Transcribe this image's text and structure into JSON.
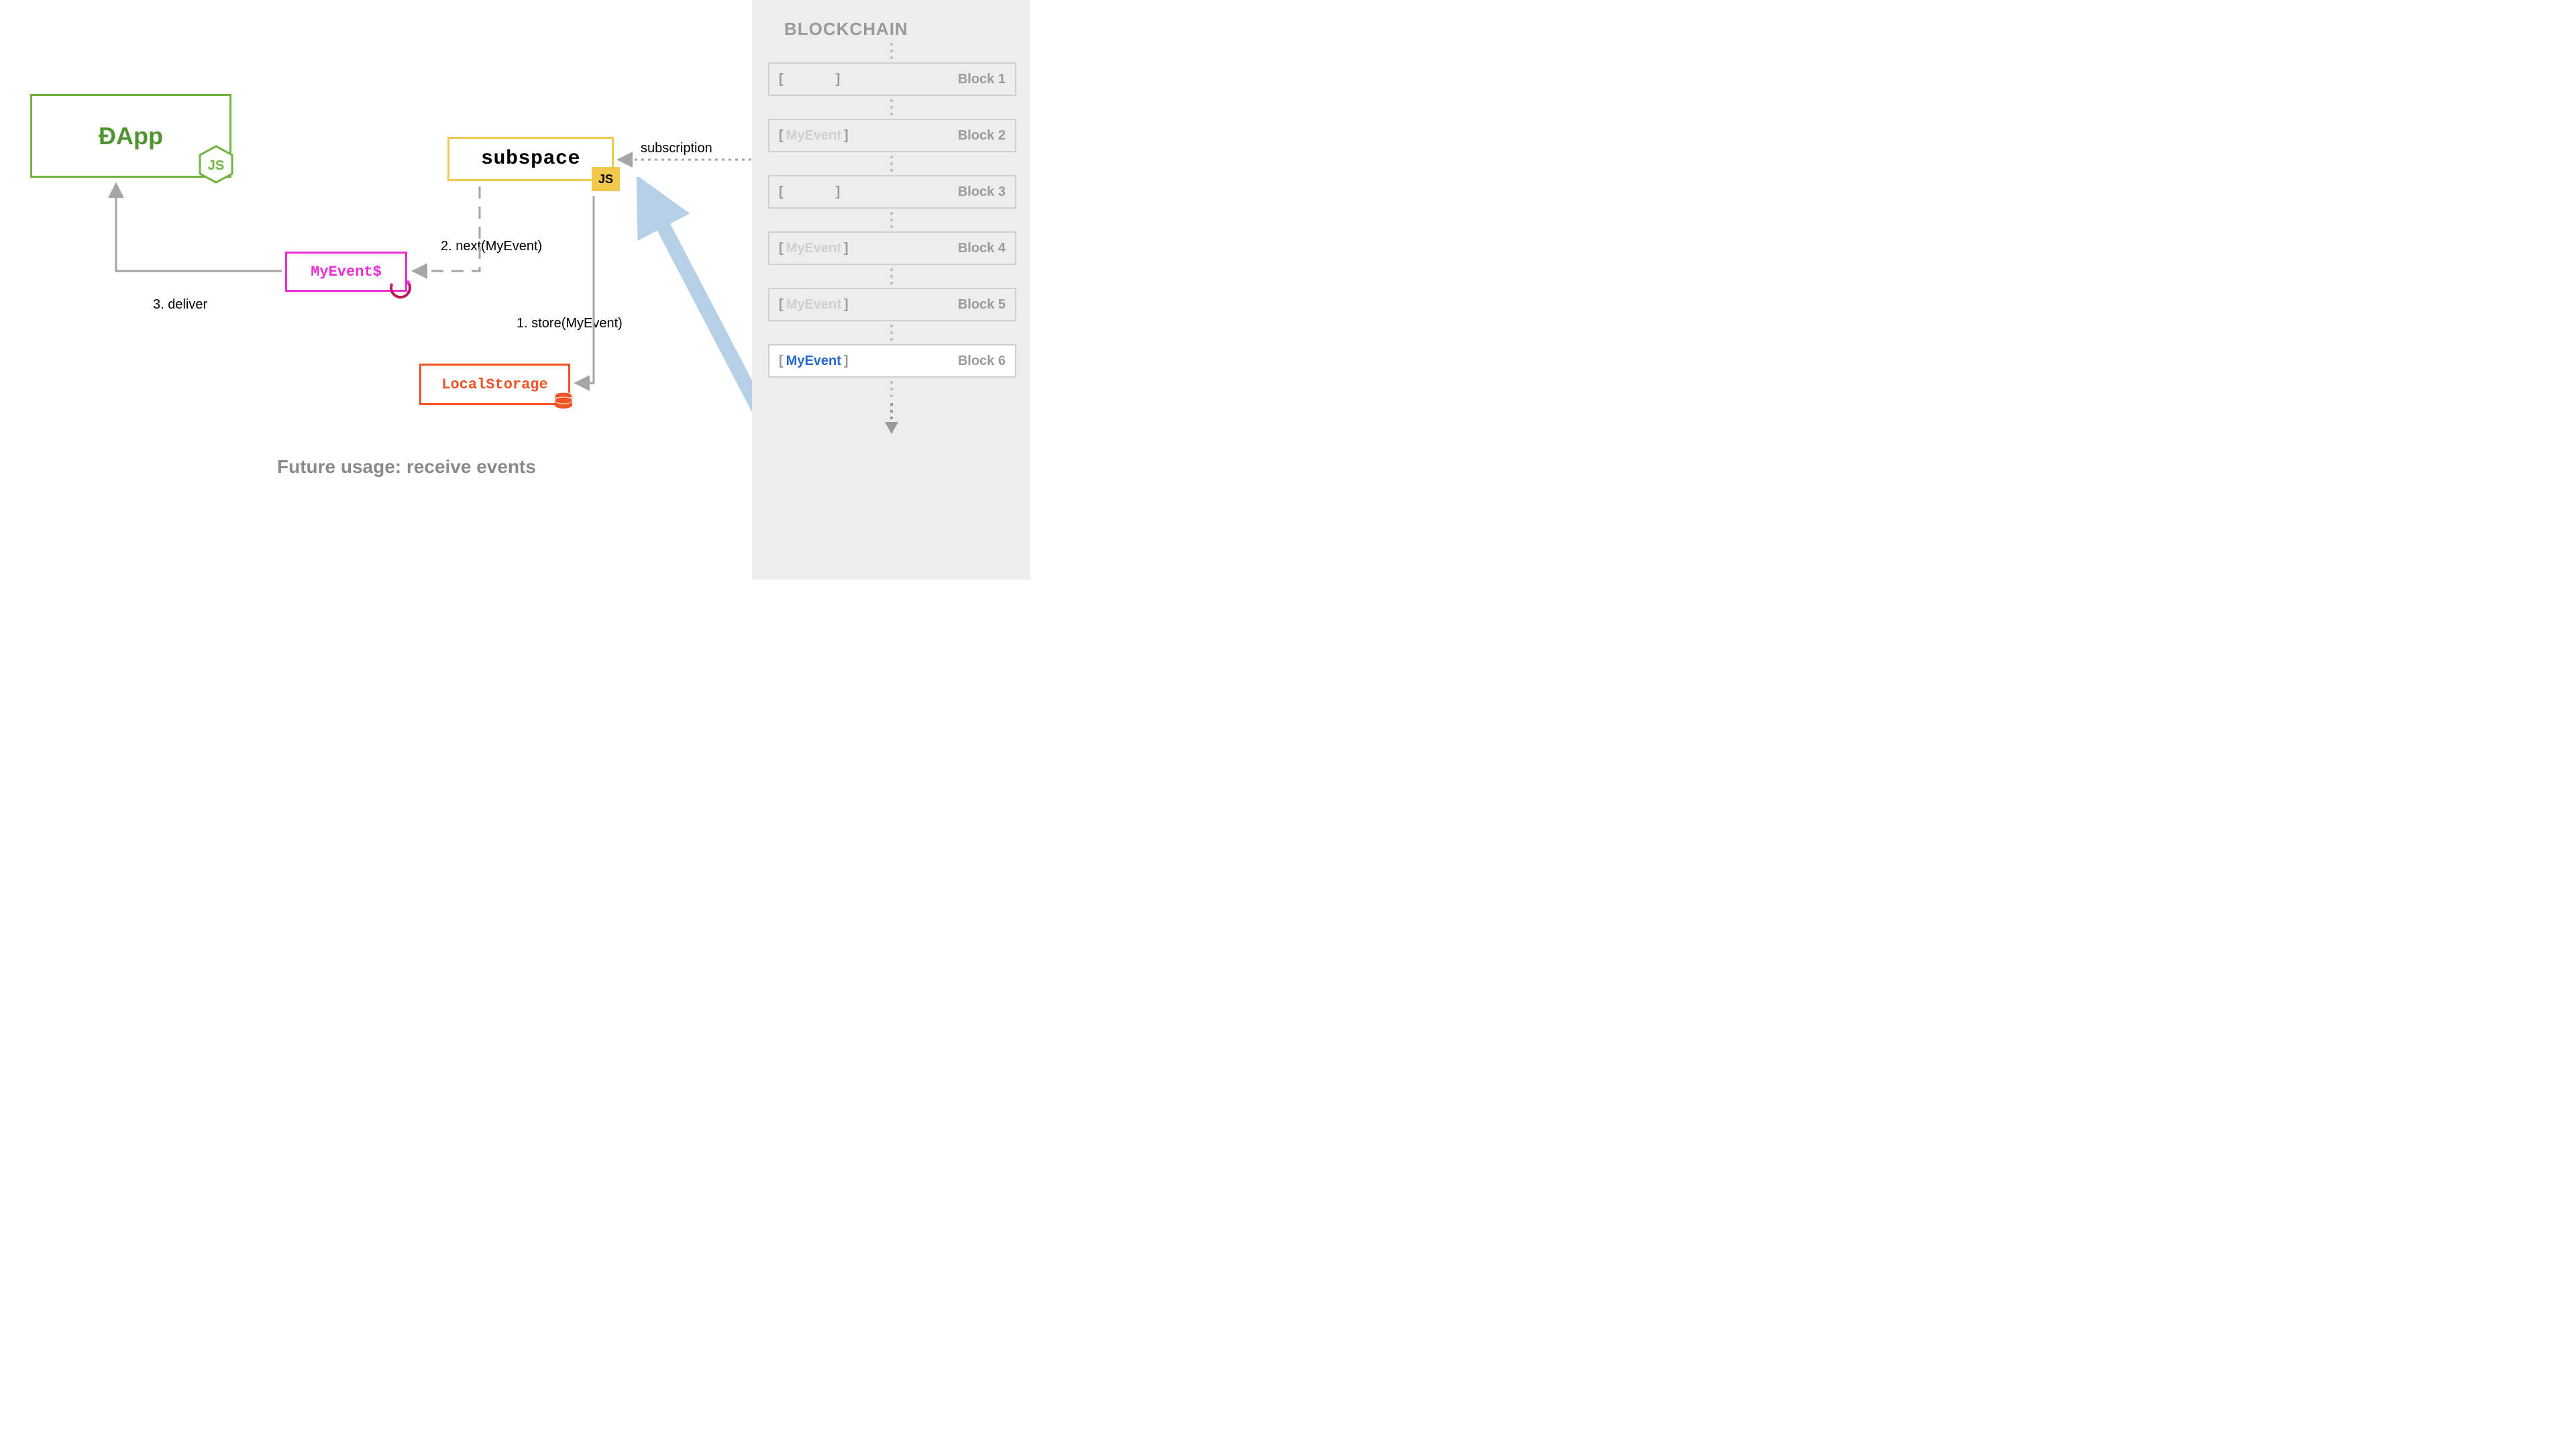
{
  "dapp": {
    "label": "ÐApp"
  },
  "subspace": {
    "label": "subspace",
    "badge": "JS"
  },
  "myevent": {
    "label": "MyEvent$"
  },
  "localstorage": {
    "label": "LocalStorage"
  },
  "labels": {
    "subscription": "subscription",
    "next": "2. next(MyEvent)",
    "store": "1. store(MyEvent)",
    "deliver": "3. deliver"
  },
  "caption": "Future usage: receive events",
  "sidebar": {
    "title": "BLOCKCHAIN",
    "blocks": [
      {
        "event": "",
        "label": "Block 1",
        "muted": true,
        "active": false
      },
      {
        "event": "MyEvent",
        "label": "Block 2",
        "muted": true,
        "active": false
      },
      {
        "event": "",
        "label": "Block 3",
        "muted": true,
        "active": false
      },
      {
        "event": "MyEvent",
        "label": "Block 4",
        "muted": true,
        "active": false
      },
      {
        "event": "MyEvent",
        "label": "Block 5",
        "muted": true,
        "active": false
      },
      {
        "event": "MyEvent",
        "label": "Block 6",
        "muted": false,
        "active": true
      }
    ]
  }
}
